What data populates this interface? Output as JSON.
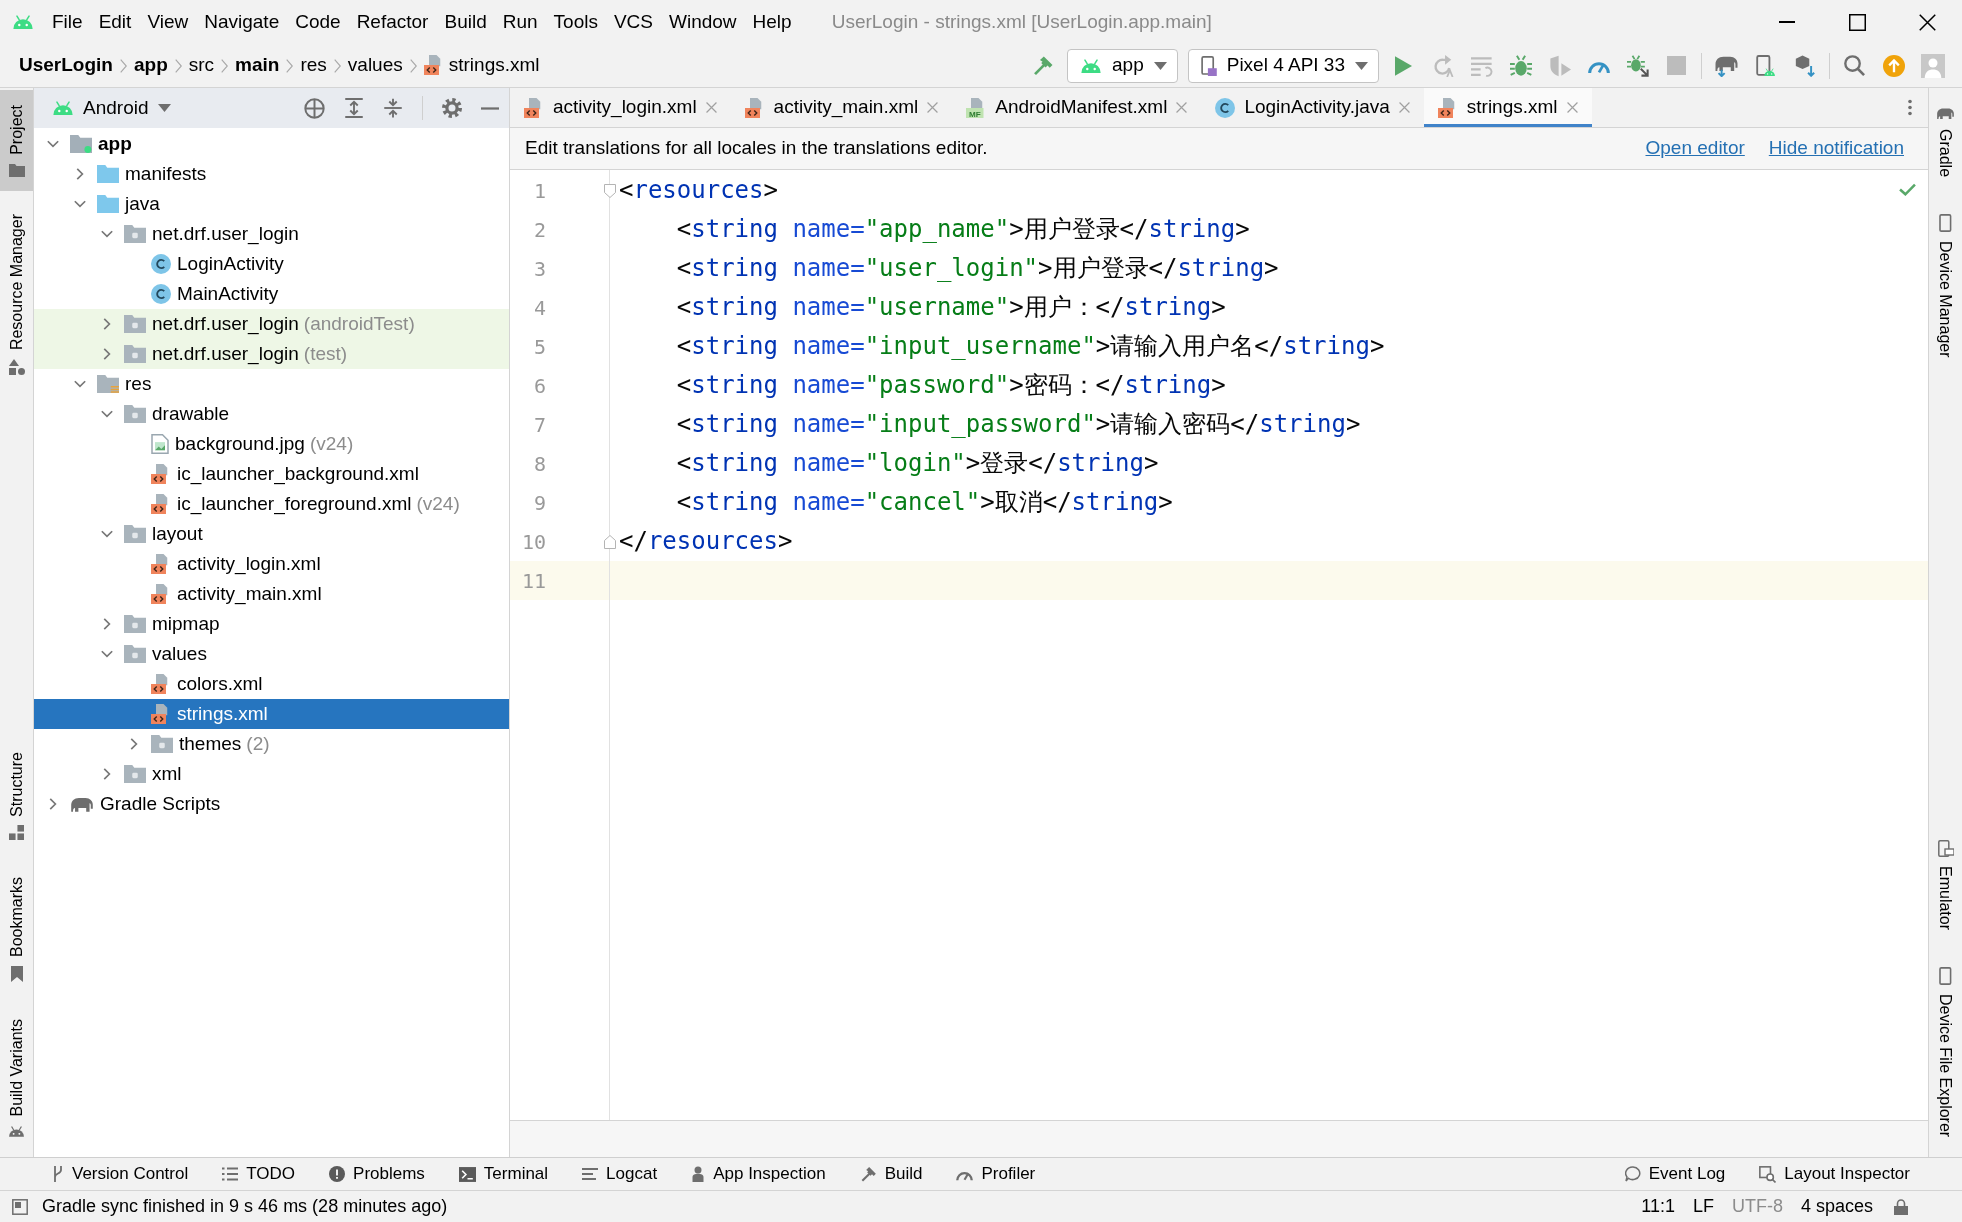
{
  "window": {
    "title": "UserLogin - strings.xml [UserLogin.app.main]"
  },
  "menu": [
    {
      "label": "File"
    },
    {
      "label": "Edit"
    },
    {
      "label": "View"
    },
    {
      "label": "Navigate"
    },
    {
      "label": "Code"
    },
    {
      "label": "Refactor"
    },
    {
      "label": "Build"
    },
    {
      "label": "Run"
    },
    {
      "label": "Tools"
    },
    {
      "label": "VCS"
    },
    {
      "label": "Window"
    },
    {
      "label": "Help"
    }
  ],
  "breadcrumbs": [
    {
      "label": "UserLogin",
      "kind": "project"
    },
    {
      "label": "app",
      "kind": "module"
    },
    {
      "label": "src",
      "kind": "folder"
    },
    {
      "label": "main",
      "kind": "source-set"
    },
    {
      "label": "res",
      "kind": "folder"
    },
    {
      "label": "values",
      "kind": "folder"
    },
    {
      "label": "strings.xml",
      "kind": "xml-file"
    }
  ],
  "toolbar": {
    "items": [
      {
        "kind": "build",
        "disabled": false
      },
      {
        "kind": "run-configuration",
        "label": "app"
      },
      {
        "kind": "device",
        "label": "Pixel 4 API 33"
      },
      {
        "kind": "run",
        "disabled": false
      },
      {
        "kind": "restart",
        "disabled": true
      },
      {
        "kind": "apply-code-changes",
        "disabled": true
      },
      {
        "kind": "debug",
        "disabled": false
      },
      {
        "kind": "coverage",
        "disabled": true
      },
      {
        "kind": "profile",
        "disabled": false
      },
      {
        "kind": "attach-debugger",
        "disabled": false
      },
      {
        "kind": "stop",
        "disabled": true
      },
      {
        "kind": "separator"
      },
      {
        "kind": "sync-gradle",
        "disabled": false
      },
      {
        "kind": "device-manager",
        "disabled": false
      },
      {
        "kind": "sdk-manager",
        "disabled": false
      },
      {
        "kind": "separator"
      },
      {
        "kind": "search",
        "disabled": false
      },
      {
        "kind": "update",
        "disabled": false
      },
      {
        "kind": "account",
        "disabled": false
      }
    ]
  },
  "left_tool_strip": {
    "top": [
      {
        "label": "Project",
        "kind": "project",
        "selected": true
      },
      {
        "label": "Resource Manager",
        "kind": "resource-manager",
        "selected": false
      }
    ],
    "bottom": [
      {
        "label": "Structure",
        "kind": "structure",
        "selected": false
      },
      {
        "label": "Bookmarks",
        "kind": "bookmarks",
        "selected": false
      },
      {
        "label": "Build Variants",
        "kind": "build-variants",
        "selected": false
      }
    ]
  },
  "project_panel": {
    "view": "Android",
    "tree": [
      {
        "label": "app",
        "kind": "module",
        "expanded": true,
        "selected": false,
        "children": [
          {
            "label": "manifests",
            "kind": "source-folder",
            "expanded": false,
            "selected": false
          },
          {
            "label": "java",
            "kind": "source-folder",
            "expanded": true,
            "selected": false,
            "children": [
              {
                "label": "net.drf.user_login",
                "kind": "package",
                "expanded": true,
                "selected": false,
                "children": [
                  {
                    "label": "LoginActivity",
                    "kind": "class",
                    "selected": false
                  },
                  {
                    "label": "MainActivity",
                    "kind": "class",
                    "selected": false
                  }
                ]
              },
              {
                "label": "net.drf.user_login",
                "suffix": "(androidTest)",
                "kind": "test-package",
                "expanded": false,
                "selected": false
              },
              {
                "label": "net.drf.user_login",
                "suffix": "(test)",
                "kind": "test-package",
                "expanded": false,
                "selected": false
              }
            ]
          },
          {
            "label": "res",
            "kind": "resource-folder",
            "expanded": true,
            "selected": false,
            "children": [
              {
                "label": "drawable",
                "kind": "folder",
                "expanded": true,
                "selected": false,
                "children": [
                  {
                    "label": "background.jpg",
                    "suffix": "(v24)",
                    "kind": "image-file",
                    "selected": false
                  },
                  {
                    "label": "ic_launcher_background.xml",
                    "kind": "xml-file",
                    "selected": false
                  },
                  {
                    "label": "ic_launcher_foreground.xml",
                    "suffix": "(v24)",
                    "kind": "xml-file",
                    "selected": false
                  }
                ]
              },
              {
                "label": "layout",
                "kind": "folder",
                "expanded": true,
                "selected": false,
                "children": [
                  {
                    "label": "activity_login.xml",
                    "kind": "xml-file",
                    "selected": false
                  },
                  {
                    "label": "activity_main.xml",
                    "kind": "xml-file",
                    "selected": false
                  }
                ]
              },
              {
                "label": "mipmap",
                "kind": "folder",
                "expanded": false,
                "selected": false
              },
              {
                "label": "values",
                "kind": "folder",
                "expanded": true,
                "selected": false,
                "children": [
                  {
                    "label": "colors.xml",
                    "kind": "xml-file",
                    "selected": false
                  },
                  {
                    "label": "strings.xml",
                    "kind": "xml-file",
                    "selected": true
                  },
                  {
                    "label": "themes",
                    "suffix": "(2)",
                    "kind": "folder",
                    "expanded": false,
                    "selected": false
                  }
                ]
              },
              {
                "label": "xml",
                "kind": "folder",
                "expanded": false,
                "selected": false
              }
            ]
          }
        ]
      },
      {
        "label": "Gradle Scripts",
        "kind": "gradle",
        "expanded": false,
        "selected": false
      }
    ]
  },
  "editor": {
    "tabs": [
      {
        "label": "activity_login.xml",
        "kind": "xml-file",
        "selected": false
      },
      {
        "label": "activity_main.xml",
        "kind": "xml-file",
        "selected": false
      },
      {
        "label": "AndroidManifest.xml",
        "kind": "manifest-file",
        "icon_text": "MF",
        "selected": false
      },
      {
        "label": "LoginActivity.java",
        "kind": "class",
        "selected": false
      },
      {
        "label": "strings.xml",
        "kind": "xml-file",
        "selected": true
      }
    ],
    "notification": {
      "text": "Edit translations for all locales in the translations editor.",
      "links": [
        "Open editor",
        "Hide notification"
      ]
    },
    "lines": [
      {
        "number": "1",
        "kind": "fold-start",
        "nested": false,
        "current": false,
        "text": "<resources>"
      },
      {
        "number": "2",
        "kind": "line",
        "nested": true,
        "current": false,
        "text": "<string name=\"app_name\">用户登录</string>"
      },
      {
        "number": "3",
        "kind": "line",
        "nested": true,
        "current": false,
        "text": "<string name=\"user_login\">用户登录</string>"
      },
      {
        "number": "4",
        "kind": "line",
        "nested": true,
        "current": false,
        "text": "<string name=\"username\">用户：</string>"
      },
      {
        "number": "5",
        "kind": "line",
        "nested": true,
        "current": false,
        "text": "<string name=\"input_username\">请输入用户名</string>"
      },
      {
        "number": "6",
        "kind": "line",
        "nested": true,
        "current": false,
        "text": "<string name=\"password\">密码：</string>"
      },
      {
        "number": "7",
        "kind": "line",
        "nested": true,
        "current": false,
        "text": "<string name=\"input_password\">请输入密码</string>"
      },
      {
        "number": "8",
        "kind": "line",
        "nested": true,
        "current": false,
        "text": "<string name=\"login\">登录</string>"
      },
      {
        "number": "9",
        "kind": "line",
        "nested": true,
        "current": false,
        "text": "<string name=\"cancel\">取消</string>"
      },
      {
        "number": "10",
        "kind": "fold-end",
        "nested": false,
        "current": false,
        "text": "</resources>"
      },
      {
        "number": "11",
        "kind": "line",
        "current": true
      }
    ]
  },
  "right_tool_strip": {
    "top": [
      {
        "label": "Gradle",
        "kind": "gradle",
        "selected": false
      },
      {
        "label": "Device Manager",
        "kind": "device-manager",
        "selected": false
      }
    ],
    "bottom": [
      {
        "label": "Emulator",
        "kind": "emulator",
        "selected": false
      },
      {
        "label": "Device File Explorer",
        "kind": "device-file-explorer",
        "selected": false
      }
    ]
  },
  "tool_window_bar": {
    "left": [
      {
        "label": "Version Control",
        "kind": "version-control"
      },
      {
        "label": "TODO",
        "kind": "todo"
      },
      {
        "label": "Problems",
        "kind": "problems"
      },
      {
        "label": "Terminal",
        "kind": "terminal"
      },
      {
        "label": "Logcat",
        "kind": "logcat"
      },
      {
        "label": "App Inspection",
        "kind": "app-inspection"
      },
      {
        "label": "Build",
        "kind": "build"
      },
      {
        "label": "Profiler",
        "kind": "profiler"
      }
    ],
    "right": [
      {
        "label": "Event Log",
        "kind": "event-log"
      },
      {
        "label": "Layout Inspector",
        "kind": "layout-inspector"
      }
    ]
  },
  "status_bar": {
    "message": "Gradle sync finished in 9 s 46 ms (28 minutes ago)",
    "widgets": [
      {
        "label": "11:1",
        "disabled": false
      },
      {
        "label": "LF",
        "disabled": false
      },
      {
        "label": "UTF-8",
        "disabled": true
      },
      {
        "label": "4 spaces",
        "disabled": false
      }
    ]
  }
}
